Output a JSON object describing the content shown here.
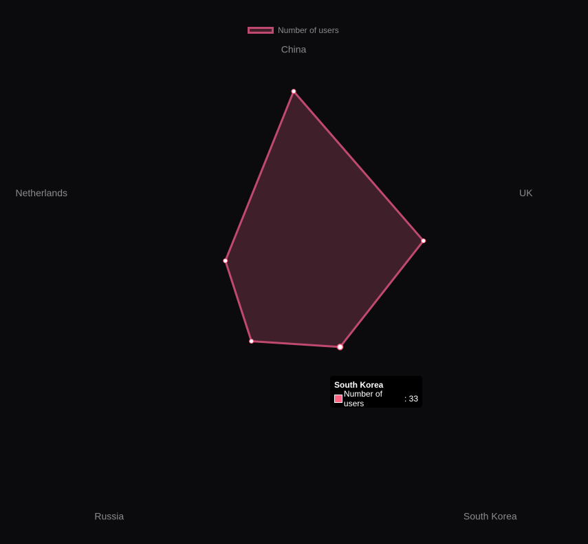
{
  "chart_data": {
    "type": "radar",
    "categories": [
      "China",
      "UK",
      "South Korea",
      "Russia",
      "Netherlands"
    ],
    "series": [
      {
        "name": "Number of users",
        "values": [
          80,
          57,
          33,
          30,
          30
        ],
        "colors": {
          "border": "#c0496f",
          "fill": "#3f1f2a",
          "point_stroke": "#ff6384",
          "point_fill": "#ffffff"
        }
      }
    ],
    "rlim": [
      0,
      100
    ],
    "grid": false,
    "legend": "top"
  },
  "tooltip": {
    "title": "South Korea",
    "label": "Number of users",
    "value": "33",
    "swatch_color": "#ff6384"
  },
  "colors": {
    "background": "#0b0b0e",
    "category_label": "#8a8a8e"
  }
}
